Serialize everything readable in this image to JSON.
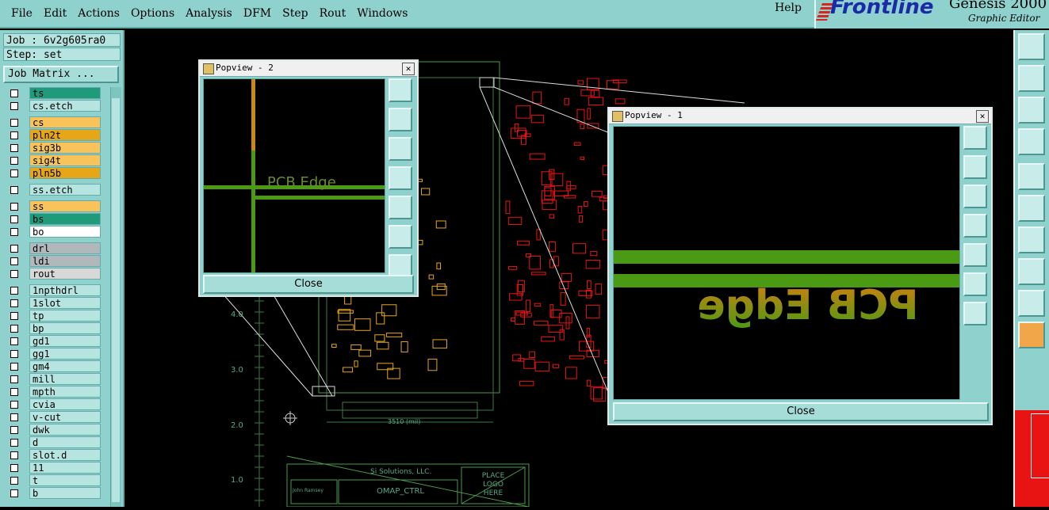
{
  "menu": [
    "File",
    "Edit",
    "Actions",
    "Options",
    "Analysis",
    "DFM",
    "Step",
    "Rout",
    "Windows"
  ],
  "help": "Help",
  "logo": {
    "brand": "Frontline",
    "product": "Genesis 2000",
    "subtitle": "Graphic Editor"
  },
  "job": {
    "job_line": "Job : 6v2g605ra0",
    "step_line": "Step: set",
    "matrix_button": "Job Matrix ..."
  },
  "layer_groups": [
    [
      {
        "name": "ts",
        "color": "#1f9a7a"
      },
      {
        "name": "cs.etch",
        "color": "#b6e4e0"
      }
    ],
    [
      {
        "name": "cs",
        "color": "#f7c35a"
      },
      {
        "name": "pln2t",
        "color": "#e6a61a"
      },
      {
        "name": "sig3b",
        "color": "#f7c35a"
      },
      {
        "name": "sig4t",
        "color": "#f7c35a"
      },
      {
        "name": "pln5b",
        "color": "#e6a61a"
      }
    ],
    [
      {
        "name": "ss.etch",
        "color": "#b6e4e0"
      }
    ],
    [
      {
        "name": "ss",
        "color": "#f7c35a"
      },
      {
        "name": "bs",
        "color": "#1f9a7a"
      },
      {
        "name": "bo",
        "color": "#ffffff"
      }
    ],
    [
      {
        "name": "drl",
        "color": "#b0b8bc"
      },
      {
        "name": "ldi",
        "color": "#b0b8bc"
      },
      {
        "name": "rout",
        "color": "#d8d8d8"
      }
    ],
    [
      {
        "name": "1npthdrl",
        "color": "#b6e4e0"
      },
      {
        "name": "1slot",
        "color": "#b6e4e0"
      },
      {
        "name": "tp",
        "color": "#b6e4e0"
      },
      {
        "name": "bp",
        "color": "#b6e4e0"
      },
      {
        "name": "gd1",
        "color": "#b6e4e0"
      },
      {
        "name": "gg1",
        "color": "#b6e4e0"
      },
      {
        "name": "gm4",
        "color": "#b6e4e0"
      },
      {
        "name": "mill",
        "color": "#b6e4e0"
      },
      {
        "name": "mpth",
        "color": "#b6e4e0"
      },
      {
        "name": "cvia",
        "color": "#b6e4e0"
      },
      {
        "name": "v-cut",
        "color": "#b6e4e0"
      },
      {
        "name": "dwk",
        "color": "#b6e4e0"
      },
      {
        "name": "d",
        "color": "#b6e4e0"
      },
      {
        "name": "slot.d",
        "color": "#b6e4e0"
      },
      {
        "name": "11",
        "color": "#b6e4e0"
      },
      {
        "name": "t",
        "color": "#b6e4e0"
      },
      {
        "name": "b",
        "color": "#b6e4e0"
      }
    ]
  ],
  "canvas": {
    "axis_labels": [
      "4.0",
      "3.0",
      "2.0",
      "1.0"
    ],
    "dimension_label": "3510 (mil)",
    "title_block": {
      "company": "Si Solutions, LLC.",
      "name_label": "John Ramsey",
      "part": "OMAP_CTRL",
      "logo_note": [
        "PLACE",
        "LOGO",
        "HERE"
      ]
    }
  },
  "popup2": {
    "title": "Popview - 2",
    "view_text": "PCB Edge",
    "close": "Close"
  },
  "popup1": {
    "title": "Popview - 1",
    "view_text": "PCB Edge",
    "close": "Close"
  },
  "colors": {
    "panel": "#8fd1cc",
    "trace_green": "#4a9a14",
    "layer_red": "#e81414",
    "layer_yellow": "#e6a61a"
  }
}
